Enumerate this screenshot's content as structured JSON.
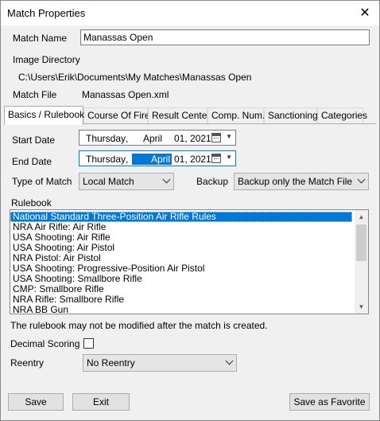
{
  "window": {
    "title": "Match Properties",
    "close_symbol": "✕"
  },
  "header": {
    "match_name_label": "Match Name",
    "match_name_value": "Manassas Open",
    "image_dir_label": "Image Directory",
    "image_dir_value": "C:\\Users\\Erik\\Documents\\My Matches\\Manassas Open",
    "match_file_label": "Match File",
    "match_file_value": "Manassas Open.xml"
  },
  "tabs": [
    {
      "label": "Basics / Rulebook"
    },
    {
      "label": "Course Of Fire"
    },
    {
      "label": "Result Center"
    },
    {
      "label": "Comp. Num."
    },
    {
      "label": "Sanctioning"
    },
    {
      "label": "Categories"
    }
  ],
  "basics": {
    "start_date_label": "Start Date",
    "start_date": {
      "weekday": "Thursday",
      "sep": ",",
      "month": "April",
      "day_year": "01, 2021"
    },
    "end_date_label": "End Date",
    "end_date": {
      "weekday": "Thursday",
      "sep": ",",
      "month": "April",
      "day_year": "01, 2021"
    },
    "type_label": "Type of Match",
    "type_value": "Local Match",
    "backup_label": "Backup",
    "backup_value": "Backup only the Match File",
    "rulebook_label": "Rulebook",
    "rulebook_items": [
      "National Standard Three-Position Air Rifle Rules",
      "NRA Air Rifle: Air Rifle",
      "USA Shooting: Air Rifle",
      "USA Shooting: Air Pistol",
      "NRA Pistol: Air Pistol",
      "USA Shooting: Progressive-Position Air Pistol",
      "USA Shooting: Smallbore Rifle",
      "CMP: Smallbore Rifle",
      "NRA Rifle: Smallbore Rifle",
      "NRA BB Gun"
    ],
    "rulebook_note": "The rulebook may not be modified after the match is created.",
    "decimal_label": "Decimal Scoring",
    "decimal_checked": false,
    "reentry_label": "Reentry",
    "reentry_value": "No Reentry"
  },
  "footer": {
    "save": "Save",
    "exit": "Exit",
    "save_favorite": "Save as Favorite"
  },
  "colors": {
    "accent": "#0078d7",
    "window_bg": "#f0f0f0"
  }
}
